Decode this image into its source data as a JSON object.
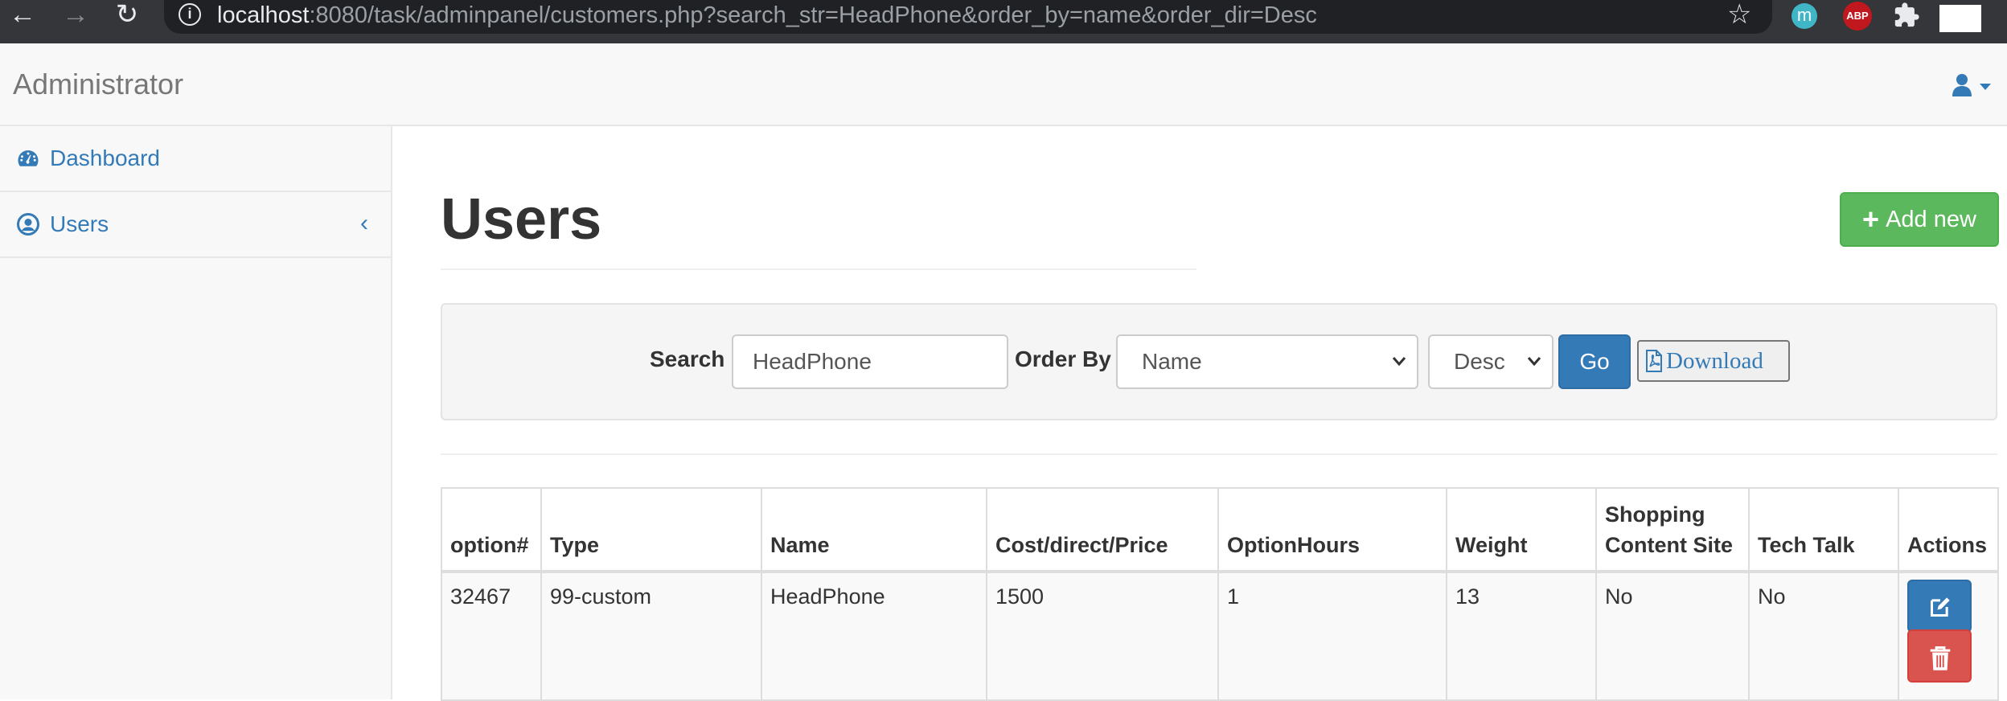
{
  "browser": {
    "url_host": "localhost",
    "url_rest": ":8080/task/adminpanel/customers.php?search_str=HeadPhone&order_by=name&order_dir=Desc",
    "ext_m_label": "m",
    "ext_abp_label": "ABP"
  },
  "header": {
    "brand": "Administrator"
  },
  "sidebar": {
    "items": [
      {
        "label": "Dashboard",
        "icon": "dashboard-icon"
      },
      {
        "label": "Users",
        "icon": "user-circle-icon",
        "chevron": "‹"
      }
    ]
  },
  "page": {
    "title": "Users",
    "add_new_label": "Add new",
    "add_new_plus": "+"
  },
  "filter": {
    "search_label": "Search",
    "search_value": "HeadPhone",
    "order_by_label": "Order By",
    "order_by_value": "Name",
    "order_dir_value": "Desc",
    "go_label": "Go",
    "download_label": "Download"
  },
  "table": {
    "columns": [
      [
        "option#"
      ],
      [
        "Type"
      ],
      [
        "Name"
      ],
      [
        "Cost/direct/Price"
      ],
      [
        "OptionHours"
      ],
      [
        "Weight"
      ],
      [
        "Shopping",
        "Content Site"
      ],
      [
        "Tech Talk"
      ],
      [
        "Actions"
      ]
    ],
    "rows": [
      [
        "32467",
        "99-custom",
        "HeadPhone",
        "1500",
        "1",
        "13",
        "No",
        "No"
      ]
    ]
  },
  "colors": {
    "primary": "#337ab7",
    "success": "#5cb85c",
    "danger": "#d9534f"
  }
}
